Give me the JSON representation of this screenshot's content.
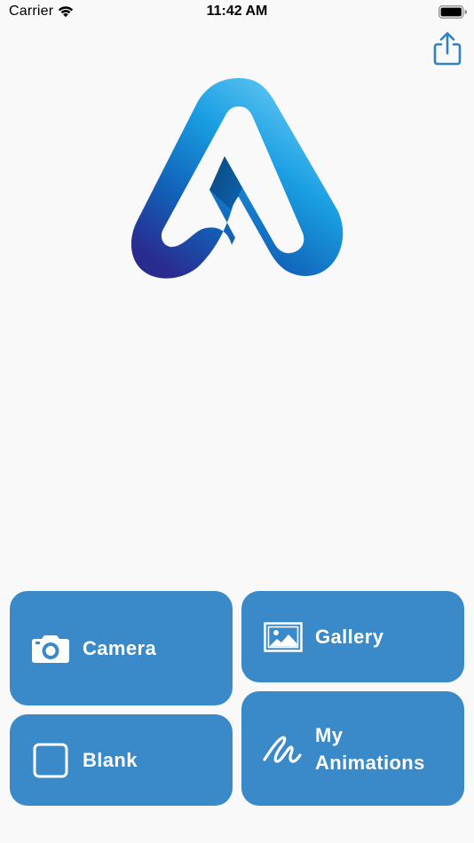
{
  "status_bar": {
    "carrier": "Carrier",
    "time": "11:42 AM",
    "wifi_icon": "wifi-icon",
    "battery_icon": "battery-full-icon"
  },
  "toolbar": {
    "share_icon": "share-icon"
  },
  "logo": {
    "icon": "app-logo",
    "colors": {
      "light": "#5fc6f2",
      "mid": "#1a86d0",
      "dark": "#2a2b8f"
    }
  },
  "tiles": {
    "camera": {
      "label": "Camera",
      "icon": "camera-icon"
    },
    "gallery": {
      "label": "Gallery",
      "icon": "image-icon"
    },
    "blank": {
      "label": "Blank",
      "icon": "blank-square-icon"
    },
    "animations": {
      "label_line1": "My",
      "label_line2": "Animations",
      "icon": "scribble-icon"
    }
  },
  "colors": {
    "background": "#f9f9f9",
    "tile": "#3a8ac9",
    "tile_text": "#ffffff",
    "accent": "#2f80c6"
  }
}
